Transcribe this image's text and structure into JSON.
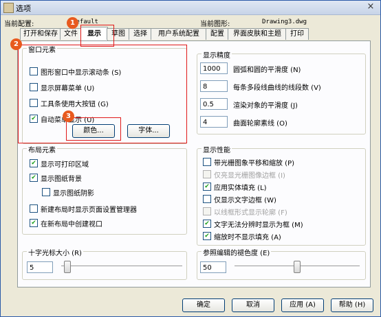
{
  "window": {
    "title": "选项",
    "close_symbol": "×"
  },
  "header": {
    "profile_label": "当前配置:",
    "profile_value": "Default",
    "drawing_label": "当前图形:",
    "drawing_value": "Drawing3.dwg"
  },
  "tabs": [
    {
      "label": "打开和保存"
    },
    {
      "label": "文件"
    },
    {
      "label": "显示"
    },
    {
      "label": "草图"
    },
    {
      "label": "选择"
    },
    {
      "label": "用户系统配置"
    },
    {
      "label": "配置"
    },
    {
      "label": "界面皮肤和主题"
    },
    {
      "label": "打印"
    }
  ],
  "window_elements": {
    "title": "窗口元素",
    "items": [
      {
        "label": "图形窗口中显示滚动条 (S)",
        "checked": false
      },
      {
        "label": "显示屏幕菜单 (U)",
        "checked": false
      },
      {
        "label": "工具条使用大按钮 (G)",
        "checked": false
      },
      {
        "label": "自动菜单显示 (U)",
        "checked": true
      }
    ],
    "color_button": "颜色...",
    "font_button": "字体..."
  },
  "layout_elements": {
    "title": "布局元素",
    "items": [
      {
        "label": "显示可打印区域",
        "checked": true
      },
      {
        "label": "显示图纸背景",
        "checked": true
      },
      {
        "label": "显示图纸阴影",
        "checked": false
      },
      {
        "label": "新建布局时显示页面设置管理器",
        "checked": false
      },
      {
        "label": "在新布局中创建视口",
        "checked": true
      }
    ]
  },
  "crosshair": {
    "title": "十字光标大小 (R)",
    "value": "5",
    "level": 5
  },
  "display_precision": {
    "title": "显示精度",
    "items": [
      {
        "value": "1000",
        "label": "圆弧和圆的平滑度 (N)"
      },
      {
        "value": "8",
        "label": "每条多段线曲线的线段数 (V)"
      },
      {
        "value": "0.5",
        "label": "渲染对象的平滑度 (J)"
      },
      {
        "value": "4",
        "label": "曲面轮廓素线 (O)"
      }
    ]
  },
  "display_performance": {
    "title": "显示性能",
    "items": [
      {
        "label": "带光栅图象平移和缩放 (P)",
        "checked": false,
        "disabled": false
      },
      {
        "label": "仅亮显光栅图像边框 (I)",
        "checked": false,
        "disabled": true
      },
      {
        "label": "应用实体填充 (L)",
        "checked": true,
        "disabled": false
      },
      {
        "label": "仅显示文字边框 (W)",
        "checked": false,
        "disabled": false
      },
      {
        "label": "以线框形式显示轮廓 (F)",
        "checked": false,
        "disabled": true
      },
      {
        "label": "文字无法分辨时显示为框 (M)",
        "checked": true,
        "disabled": false
      },
      {
        "label": "缩放时不显示填充 (A)",
        "checked": true,
        "disabled": false
      }
    ]
  },
  "xref_fade": {
    "title": "参照编辑的褪色度 (E)",
    "value": "50",
    "level": 50
  },
  "footer": {
    "ok": "确定",
    "cancel": "取消",
    "apply": "应用 (A)",
    "help": "帮助 (H)"
  },
  "badges": [
    "1",
    "2",
    "3"
  ],
  "colors": {
    "highlight": "#e01818",
    "badge": "#e85a1e",
    "titlebar": "#c7d4e8"
  }
}
